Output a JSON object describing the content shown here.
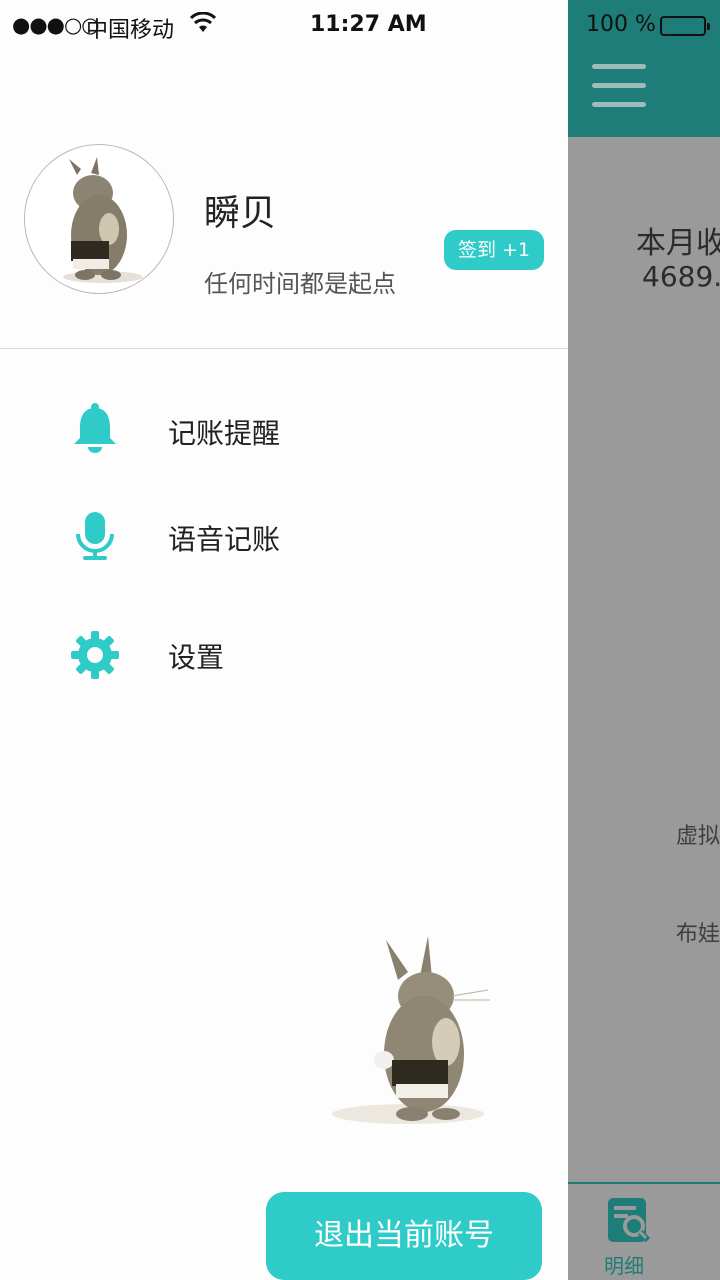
{
  "status_bar": {
    "signal": "●●●○○",
    "carrier": "中国移动",
    "time": "11:27 AM",
    "battery": "100 %"
  },
  "profile": {
    "name": "瞬贝",
    "motto": "任何时间都是起点",
    "checkin_label": "签到 +1"
  },
  "menu": {
    "items": [
      {
        "label": "记账提醒",
        "icon": "bell-icon"
      },
      {
        "label": "语音记账",
        "icon": "microphone-icon"
      },
      {
        "label": "设置",
        "icon": "gear-icon"
      }
    ]
  },
  "logout_label": "退出当前账号",
  "background": {
    "month_label": "本月收",
    "month_value": "4689.",
    "item1": "虚拟",
    "item2": "布娃",
    "tab_label": "明细"
  },
  "colors": {
    "accent": "#2fcbc8",
    "header": "#1e7d78",
    "overlay": "#9a9a9a"
  }
}
